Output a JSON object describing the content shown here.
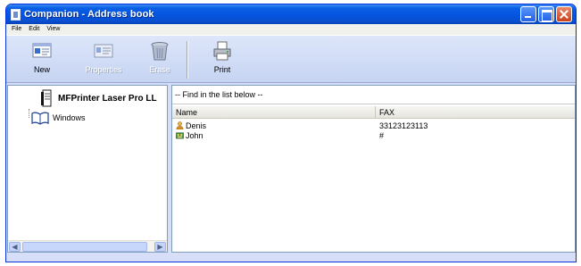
{
  "window": {
    "title": "Companion - Address book"
  },
  "menu": {
    "items": [
      "File",
      "Edit",
      "View"
    ]
  },
  "toolbar": {
    "buttons": [
      {
        "label": "New",
        "icon": "address-card-icon",
        "enabled": true
      },
      {
        "label": "Properties",
        "icon": "properties-icon",
        "enabled": false
      },
      {
        "label": "Erase",
        "icon": "trash-can-icon",
        "enabled": false
      },
      {
        "label": "Print",
        "icon": "printer-icon",
        "enabled": true
      }
    ]
  },
  "tree": {
    "items": [
      {
        "label": "MFPrinter Laser Pro LL",
        "icon": "printer-device-icon",
        "bold": true
      },
      {
        "label": "Windows",
        "icon": "open-book-icon",
        "bold": false
      }
    ]
  },
  "list": {
    "find_text": "-- Find in the list below --",
    "columns": [
      "Name",
      "FAX"
    ],
    "rows": [
      {
        "name": "Denis",
        "fax": "33123123113",
        "icon": "contact-person-icon"
      },
      {
        "name": "John",
        "fax": "#",
        "icon": "contact-group-icon"
      }
    ]
  },
  "colors": {
    "titlebar": "#0454e0",
    "window_bg": "#d6dff7",
    "pane_border": "#7f9db9"
  }
}
